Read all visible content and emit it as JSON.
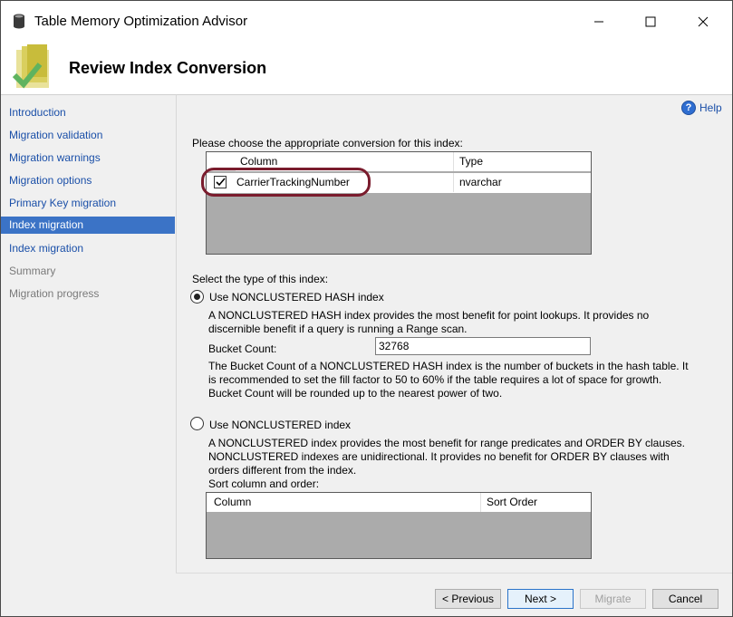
{
  "window": {
    "title": "Table Memory Optimization Advisor",
    "controls": {
      "minimize": "—",
      "maximize": "☐",
      "close": "✕"
    }
  },
  "header": {
    "page_title": "Review Index Conversion"
  },
  "help": {
    "label": "Help",
    "icon": "?"
  },
  "sidebar": {
    "items": [
      {
        "label": "Introduction",
        "state": "link"
      },
      {
        "label": "Migration validation",
        "state": "link"
      },
      {
        "label": "Migration warnings",
        "state": "link"
      },
      {
        "label": "Migration options",
        "state": "link"
      },
      {
        "label": "Primary Key migration",
        "state": "link"
      },
      {
        "label": "Index migration",
        "state": "active"
      },
      {
        "label": "Index migration",
        "state": "link"
      },
      {
        "label": "Summary",
        "state": "disabled"
      },
      {
        "label": "Migration progress",
        "state": "disabled"
      }
    ]
  },
  "conversion": {
    "prompt": "Please choose the appropriate conversion for this index:",
    "columns": [
      "Column",
      "Type"
    ],
    "rows": [
      {
        "checked": true,
        "column": "CarrierTrackingNumber",
        "type": "nvarchar"
      }
    ]
  },
  "index_type": {
    "prompt": "Select the type of this index:",
    "hash": {
      "label": "Use NONCLUSTERED HASH index",
      "selected": true,
      "description_1": "A NONCLUSTERED HASH index provides the most benefit for point lookups. It provides no",
      "description_2": "discernible benefit if a query is running a Range scan.",
      "bucket_label": "Bucket Count:",
      "bucket_value": "32768",
      "bucket_note_1": "The Bucket Count of a NONCLUSTERED HASH index is the number of buckets in the hash table. It",
      "bucket_note_2": "is recommended to set the fill factor to 50 to 60% if the table requires a lot of space for growth.",
      "bucket_note_3": "Bucket Count will be rounded up to the nearest power of two."
    },
    "nonclustered": {
      "label": "Use NONCLUSTERED index",
      "selected": false,
      "description_1": "A NONCLUSTERED index provides the most benefit for range predicates and ORDER BY clauses.",
      "description_2": "NONCLUSTERED indexes are unidirectional. It provides no benefit for ORDER BY clauses with",
      "description_3": "orders different from the index.",
      "sort_label": "Sort column and order:",
      "sort_columns": [
        "Column",
        "Sort Order"
      ]
    }
  },
  "footer": {
    "previous": "< Previous",
    "next": "Next >",
    "migrate": "Migrate",
    "cancel": "Cancel"
  },
  "colors": {
    "accent": "#3b73c6",
    "link": "#1a4fa8",
    "highlight_oval": "#7a1c2d",
    "grid_empty": "#ababab"
  }
}
